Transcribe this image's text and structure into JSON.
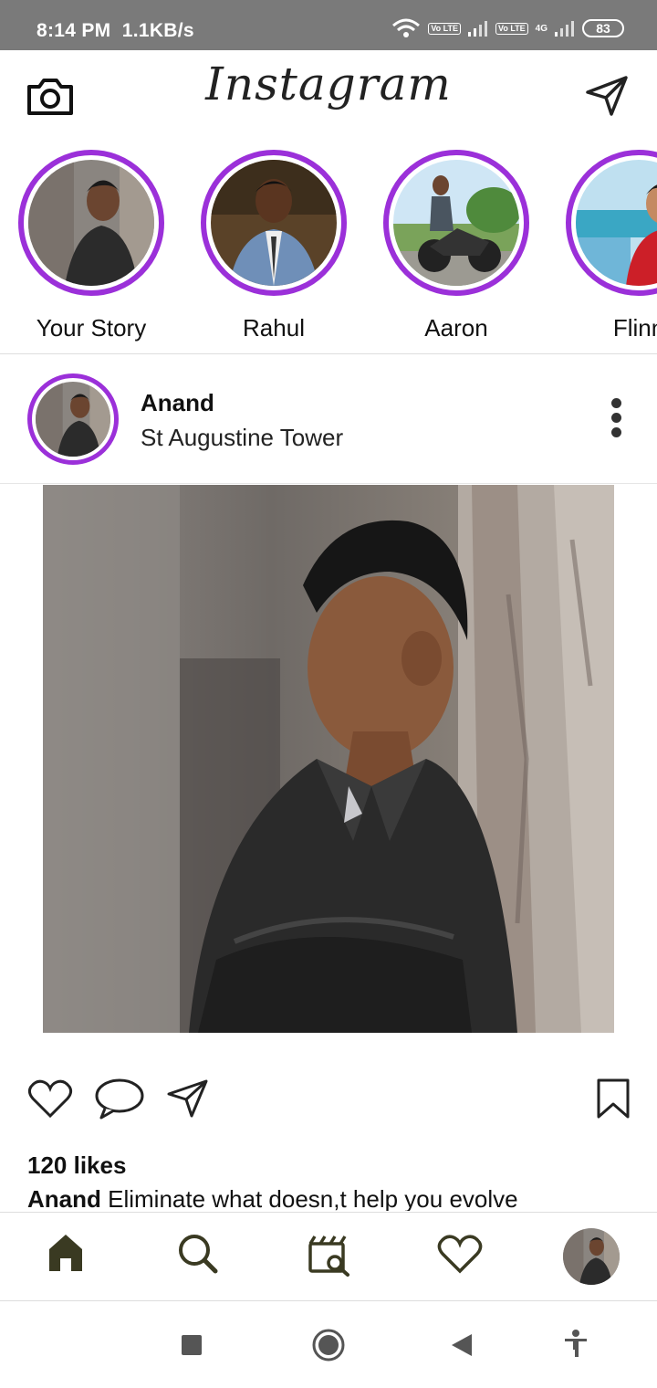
{
  "status_bar": {
    "time": "8:14 PM",
    "speed": "1.1KB/s",
    "volte1": "Vo LTE",
    "volte2": "Vo LTE",
    "network": "4G",
    "battery": "83"
  },
  "header": {
    "logo_text": "Instagram",
    "camera_icon": "camera-icon",
    "direct_icon": "paper-plane-icon"
  },
  "stories": [
    {
      "name": "Your Story"
    },
    {
      "name": "Rahul"
    },
    {
      "name": "Aaron"
    },
    {
      "name": "Flinn"
    }
  ],
  "post": {
    "username": "Anand",
    "location": "St Augustine Tower",
    "likes": "120 likes",
    "caption_user": "Anand",
    "caption_text": " Eliminate what doesn,t help you evolve"
  },
  "bottom_nav": [
    "home-icon",
    "search-icon",
    "reels-icon",
    "heart-icon",
    "profile-avatar"
  ],
  "colors": {
    "story_ring": "#9b30d9",
    "status_bar": "#7a7a7a",
    "nav_icon": "#3a3a22"
  }
}
